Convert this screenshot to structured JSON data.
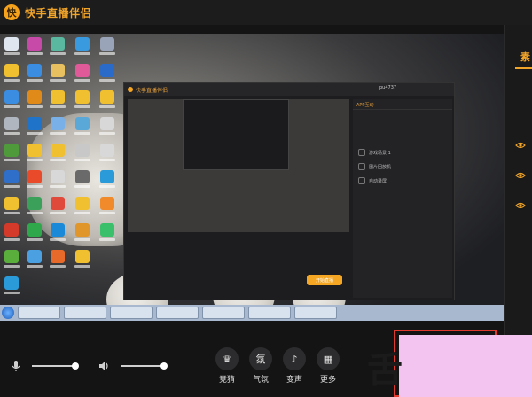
{
  "app": {
    "title": "快手直播伴侣",
    "logo_glyph": "快",
    "accent": "#f0a42a"
  },
  "right_panel": {
    "tab_label": "素",
    "eye_count": 3
  },
  "inner_window": {
    "title": "快手直播伴侣",
    "user": "pu4737",
    "side_tab": "APP互动",
    "rows": [
      {
        "label": "游戏场景 1"
      },
      {
        "label": "图片回放机"
      },
      {
        "label": "自动录屏"
      }
    ],
    "start_label": "开始直播"
  },
  "controls": {
    "mic_icon": "microphone-icon",
    "speaker_icon": "speaker-icon",
    "mic_level": 0.95,
    "speaker_level": 0.95,
    "functions": [
      {
        "name": "pk-button",
        "glyph": "♛",
        "label": "竞猜"
      },
      {
        "name": "atmosphere-button",
        "glyph": "氛",
        "label": "气氛"
      },
      {
        "name": "voice-change-button",
        "glyph": "♪",
        "label": "变声"
      },
      {
        "name": "more-button",
        "glyph": "▦",
        "label": "更多"
      }
    ]
  },
  "watermark": {
    "glyph": "舌"
  }
}
